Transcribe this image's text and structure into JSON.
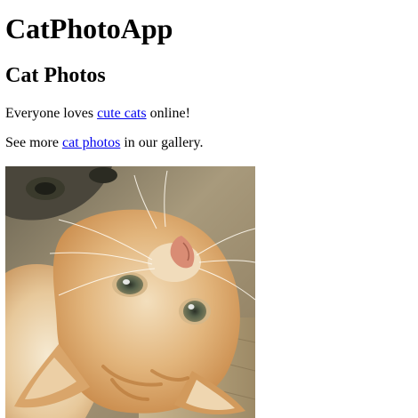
{
  "header": {
    "title": "CatPhotoApp"
  },
  "main": {
    "heading": "Cat Photos",
    "paragraph1": {
      "before": "Everyone loves ",
      "link": "cute cats",
      "after": " online!"
    },
    "paragraph2": {
      "before": "See more ",
      "link": "cat photos",
      "after": " in our gallery."
    },
    "image": {
      "alt": "A cute orange cat lying on its back."
    }
  },
  "colors": {
    "link": "#0000ee",
    "text": "#000000",
    "background": "#ffffff"
  }
}
